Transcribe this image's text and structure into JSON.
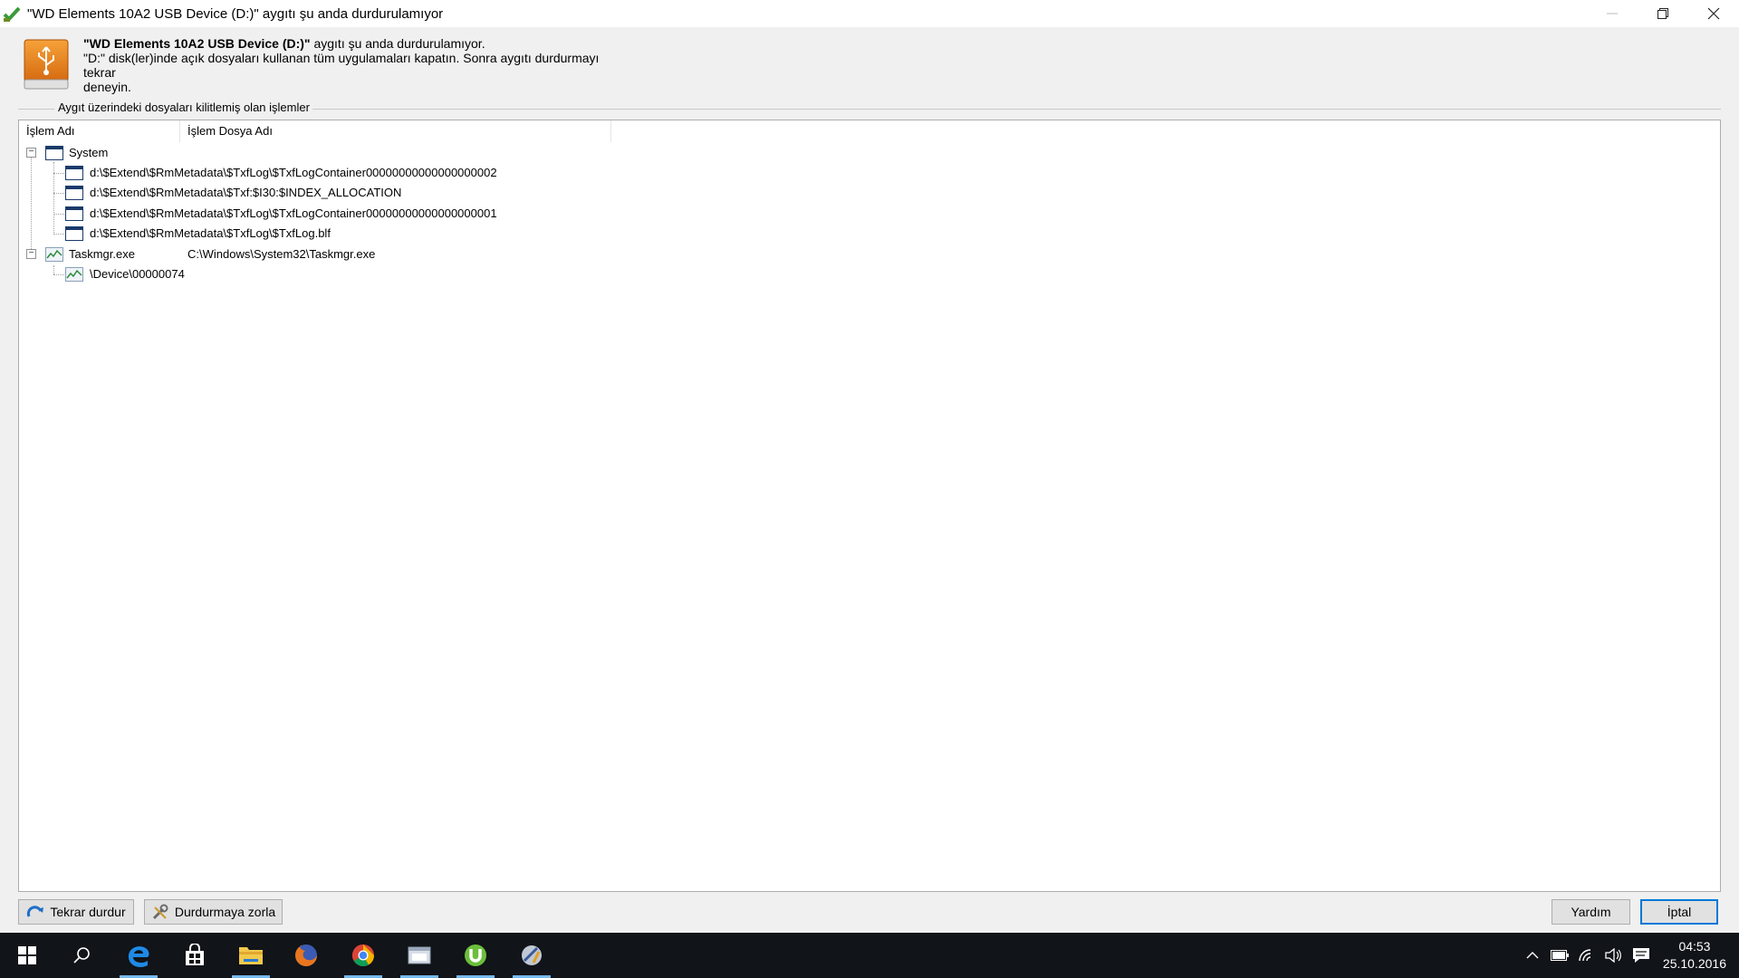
{
  "window": {
    "title": "\"WD Elements 10A2 USB Device (D:)\" aygıtı şu anda durdurulamıyor"
  },
  "message": {
    "device_bold": "\"WD Elements 10A2 USB Device (D:)\"",
    "line1_rest": " aygıtı şu anda durdurulamıyor.",
    "line2": "\"D:\" disk(ler)inde açık dosyaları kullanan tüm uygulamaları kapatın. Sonra aygıtı durdurmayı tekrar",
    "line3": "deneyin."
  },
  "group": {
    "label": "Aygıt üzerindeki dosyaları kilitlemiş olan işlemler"
  },
  "columns": [
    "İşlem Adı",
    "İşlem Dosya Adı"
  ],
  "tree": {
    "system": {
      "name": "System",
      "children": [
        "d:\\$Extend\\$RmMetadata\\$TxfLog\\$TxfLogContainer00000000000000000002",
        "d:\\$Extend\\$RmMetadata\\$Txf:$I30:$INDEX_ALLOCATION",
        "d:\\$Extend\\$RmMetadata\\$TxfLog\\$TxfLogContainer00000000000000000001",
        "d:\\$Extend\\$RmMetadata\\$TxfLog\\$TxfLog.blf"
      ]
    },
    "taskmgr": {
      "name": "Taskmgr.exe",
      "path": "C:\\Windows\\System32\\Taskmgr.exe",
      "children": [
        "\\Device\\00000074"
      ]
    }
  },
  "buttons": {
    "retry": "Tekrar durdur",
    "force": "Durdurmaya zorla",
    "help": "Yardım",
    "cancel": "İptal"
  },
  "taskbar": {
    "time": "04:53",
    "date": "25.10.2016"
  },
  "colors": {
    "accent": "#0078d7",
    "taskbar": "#111418"
  }
}
